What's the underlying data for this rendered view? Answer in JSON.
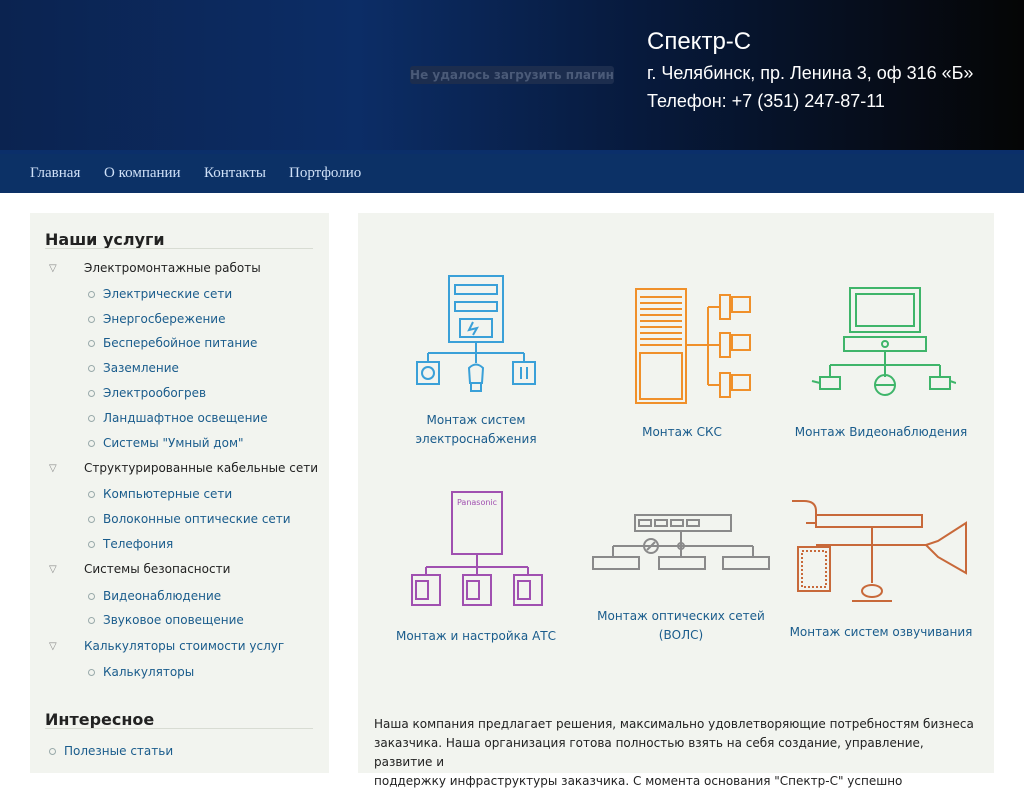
{
  "header": {
    "plugin_error": "Не удалось загрузить плагин",
    "company": "Спектр-С",
    "address": "г. Челябинск, пр. Ленина 3, оф 316 «Б»",
    "phone": "Телефон: +7 (351) 247-87-11"
  },
  "nav": {
    "items": [
      {
        "label": "Главная"
      },
      {
        "label": "О компании"
      },
      {
        "label": "Контакты"
      },
      {
        "label": "Портфолио"
      }
    ]
  },
  "sidebar": {
    "services_title": "Наши услуги",
    "categories": [
      {
        "label": "Электромонтажные работы",
        "items": [
          "Электрические сети",
          "Энергосбережение",
          "Бесперебойное питание",
          "Заземление",
          "Электрообогрев",
          "Ландшафтное освещение",
          "Системы \"Умный дом\""
        ]
      },
      {
        "label": "Структурированные кабельные сети",
        "items": [
          "Компьютерные сети",
          "Волоконные оптические сети",
          "Телефония"
        ]
      },
      {
        "label": "Системы безопасности",
        "items": [
          "Видеонаблюдение",
          "Звуковое оповещение"
        ]
      },
      {
        "label": "Калькуляторы стоимости услуг",
        "items": [
          "Калькуляторы"
        ]
      }
    ],
    "interesting_title": "Интересное",
    "interesting_items": [
      "Полезные статьи"
    ]
  },
  "main": {
    "services": [
      {
        "line1": "Монтаж систем",
        "line2": "электроснабжения",
        "icon": "power-supply-icon",
        "color": "#3aa0d8"
      },
      {
        "line1": "Монтаж СКС",
        "line2": "",
        "icon": "structured-cabling-icon",
        "color": "#f0902a"
      },
      {
        "line1": "Монтаж Видеонаблюдения",
        "line2": "",
        "icon": "cctv-icon",
        "color": "#3fb56a"
      },
      {
        "line1": "Монтаж и настройка АТС",
        "line2": "",
        "icon": "pbx-icon",
        "color": "#a050b0",
        "icon_text": "Panasonic"
      },
      {
        "line1": "Монтаж оптических сетей",
        "line2": "(ВОЛС)",
        "icon": "fiber-network-icon",
        "color": "#8a8a8a"
      },
      {
        "line1": "Монтаж систем озвучивания",
        "line2": "",
        "icon": "sound-system-icon",
        "color": "#c8693a"
      }
    ],
    "about": {
      "line1": "Наша компания предлагает решения, максимально удовлетворяющие потребностям бизнеса",
      "line2": "заказчика. Наша организация готова полностью взять на себя создание, управление, развитие и",
      "line3": "поддержку инфраструктуры заказчика. С момента основания  \"Спектр-С\" успешно"
    }
  }
}
